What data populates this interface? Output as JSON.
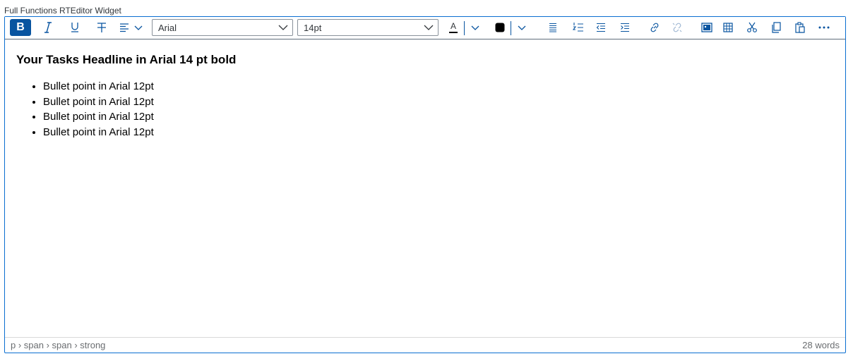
{
  "widget": {
    "title": "Full Functions RTEditor Widget"
  },
  "toolbar": {
    "bold_label": "B",
    "font_family": "Arial",
    "font_size": "14pt",
    "font_color_label": "A",
    "accent_color": "#0854a0",
    "text_color": "#000000",
    "icons": [
      "bold-icon",
      "italic-icon",
      "underline-icon",
      "strikethrough-icon",
      "align-left-icon",
      "text-color-icon",
      "background-color-icon",
      "unordered-list-icon",
      "ordered-list-icon",
      "outdent-icon",
      "indent-icon",
      "link-icon",
      "unlink-icon",
      "image-icon",
      "table-icon",
      "cut-icon",
      "copy-icon",
      "paste-icon",
      "more-icon"
    ]
  },
  "content": {
    "headline": "Your Tasks Headline in Arial 14 pt bold",
    "bullets": [
      "Bullet point in Arial 12pt",
      "Bullet point in Arial 12pt",
      "Bullet point in Arial 12pt",
      "Bullet point in Arial 12pt"
    ]
  },
  "statusbar": {
    "path": "p › span › span › strong",
    "word_count": "28 words"
  }
}
